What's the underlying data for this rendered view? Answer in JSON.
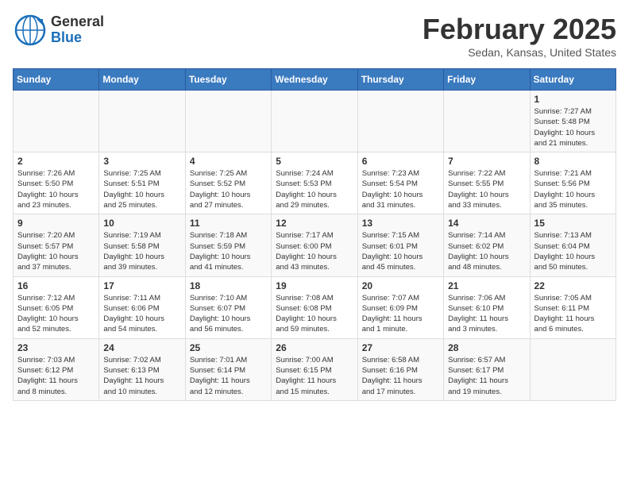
{
  "header": {
    "logo_line1": "General",
    "logo_line2": "Blue",
    "title": "February 2025",
    "subtitle": "Sedan, Kansas, United States"
  },
  "calendar": {
    "days_of_week": [
      "Sunday",
      "Monday",
      "Tuesday",
      "Wednesday",
      "Thursday",
      "Friday",
      "Saturday"
    ],
    "weeks": [
      [
        {
          "day": "",
          "info": ""
        },
        {
          "day": "",
          "info": ""
        },
        {
          "day": "",
          "info": ""
        },
        {
          "day": "",
          "info": ""
        },
        {
          "day": "",
          "info": ""
        },
        {
          "day": "",
          "info": ""
        },
        {
          "day": "1",
          "info": "Sunrise: 7:27 AM\nSunset: 5:48 PM\nDaylight: 10 hours\nand 21 minutes."
        }
      ],
      [
        {
          "day": "2",
          "info": "Sunrise: 7:26 AM\nSunset: 5:50 PM\nDaylight: 10 hours\nand 23 minutes."
        },
        {
          "day": "3",
          "info": "Sunrise: 7:25 AM\nSunset: 5:51 PM\nDaylight: 10 hours\nand 25 minutes."
        },
        {
          "day": "4",
          "info": "Sunrise: 7:25 AM\nSunset: 5:52 PM\nDaylight: 10 hours\nand 27 minutes."
        },
        {
          "day": "5",
          "info": "Sunrise: 7:24 AM\nSunset: 5:53 PM\nDaylight: 10 hours\nand 29 minutes."
        },
        {
          "day": "6",
          "info": "Sunrise: 7:23 AM\nSunset: 5:54 PM\nDaylight: 10 hours\nand 31 minutes."
        },
        {
          "day": "7",
          "info": "Sunrise: 7:22 AM\nSunset: 5:55 PM\nDaylight: 10 hours\nand 33 minutes."
        },
        {
          "day": "8",
          "info": "Sunrise: 7:21 AM\nSunset: 5:56 PM\nDaylight: 10 hours\nand 35 minutes."
        }
      ],
      [
        {
          "day": "9",
          "info": "Sunrise: 7:20 AM\nSunset: 5:57 PM\nDaylight: 10 hours\nand 37 minutes."
        },
        {
          "day": "10",
          "info": "Sunrise: 7:19 AM\nSunset: 5:58 PM\nDaylight: 10 hours\nand 39 minutes."
        },
        {
          "day": "11",
          "info": "Sunrise: 7:18 AM\nSunset: 5:59 PM\nDaylight: 10 hours\nand 41 minutes."
        },
        {
          "day": "12",
          "info": "Sunrise: 7:17 AM\nSunset: 6:00 PM\nDaylight: 10 hours\nand 43 minutes."
        },
        {
          "day": "13",
          "info": "Sunrise: 7:15 AM\nSunset: 6:01 PM\nDaylight: 10 hours\nand 45 minutes."
        },
        {
          "day": "14",
          "info": "Sunrise: 7:14 AM\nSunset: 6:02 PM\nDaylight: 10 hours\nand 48 minutes."
        },
        {
          "day": "15",
          "info": "Sunrise: 7:13 AM\nSunset: 6:04 PM\nDaylight: 10 hours\nand 50 minutes."
        }
      ],
      [
        {
          "day": "16",
          "info": "Sunrise: 7:12 AM\nSunset: 6:05 PM\nDaylight: 10 hours\nand 52 minutes."
        },
        {
          "day": "17",
          "info": "Sunrise: 7:11 AM\nSunset: 6:06 PM\nDaylight: 10 hours\nand 54 minutes."
        },
        {
          "day": "18",
          "info": "Sunrise: 7:10 AM\nSunset: 6:07 PM\nDaylight: 10 hours\nand 56 minutes."
        },
        {
          "day": "19",
          "info": "Sunrise: 7:08 AM\nSunset: 6:08 PM\nDaylight: 10 hours\nand 59 minutes."
        },
        {
          "day": "20",
          "info": "Sunrise: 7:07 AM\nSunset: 6:09 PM\nDaylight: 11 hours\nand 1 minute."
        },
        {
          "day": "21",
          "info": "Sunrise: 7:06 AM\nSunset: 6:10 PM\nDaylight: 11 hours\nand 3 minutes."
        },
        {
          "day": "22",
          "info": "Sunrise: 7:05 AM\nSunset: 6:11 PM\nDaylight: 11 hours\nand 6 minutes."
        }
      ],
      [
        {
          "day": "23",
          "info": "Sunrise: 7:03 AM\nSunset: 6:12 PM\nDaylight: 11 hours\nand 8 minutes."
        },
        {
          "day": "24",
          "info": "Sunrise: 7:02 AM\nSunset: 6:13 PM\nDaylight: 11 hours\nand 10 minutes."
        },
        {
          "day": "25",
          "info": "Sunrise: 7:01 AM\nSunset: 6:14 PM\nDaylight: 11 hours\nand 12 minutes."
        },
        {
          "day": "26",
          "info": "Sunrise: 7:00 AM\nSunset: 6:15 PM\nDaylight: 11 hours\nand 15 minutes."
        },
        {
          "day": "27",
          "info": "Sunrise: 6:58 AM\nSunset: 6:16 PM\nDaylight: 11 hours\nand 17 minutes."
        },
        {
          "day": "28",
          "info": "Sunrise: 6:57 AM\nSunset: 6:17 PM\nDaylight: 11 hours\nand 19 minutes."
        },
        {
          "day": "",
          "info": ""
        }
      ]
    ]
  }
}
